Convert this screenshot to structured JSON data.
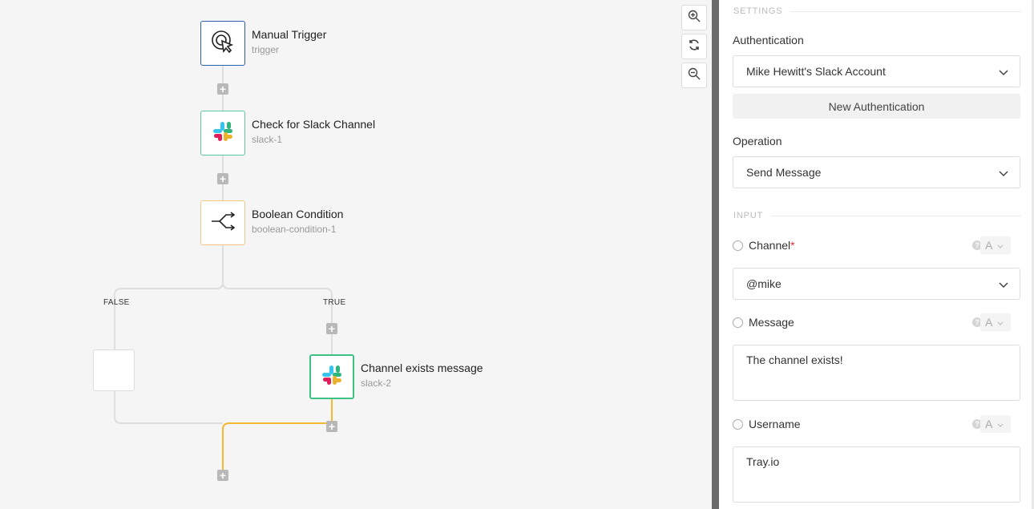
{
  "canvas": {
    "nodes": [
      {
        "id": "manual",
        "title": "Manual Trigger",
        "subtitle": "trigger",
        "icon": "cursor-click-icon",
        "border_color": "#2f5fa8"
      },
      {
        "id": "slack1",
        "title": "Check for Slack Channel",
        "subtitle": "slack-1",
        "icon": "slack-icon",
        "border_color": "#5ec7a0"
      },
      {
        "id": "bool",
        "title": "Boolean Condition",
        "subtitle": "boolean-condition-1",
        "icon": "branch-icon",
        "border_color": "#f5c784"
      },
      {
        "id": "slack2",
        "title": "Channel exists message",
        "subtitle": "slack-2",
        "icon": "slack-icon",
        "border_color": "#3fc186"
      }
    ],
    "branches": {
      "false_label": "FALSE",
      "true_label": "TRUE"
    },
    "active_path_color": "#f5b82e",
    "zoom_controls": [
      "zoom-in-icon",
      "refresh-icon",
      "zoom-out-icon"
    ]
  },
  "panel": {
    "settings_title": "SETTINGS",
    "authentication_label": "Authentication",
    "authentication_value": "Mike Hewitt's Slack Account",
    "new_auth_button": "New Authentication",
    "operation_label": "Operation",
    "operation_value": "Send Message",
    "input_title": "INPUT",
    "channel_label": "Channel",
    "channel_required": "*",
    "channel_value": "@mike",
    "message_label": "Message",
    "message_value": "The channel exists!",
    "username_label": "Username",
    "username_value": "Tray.io",
    "type_glyph": "A"
  }
}
